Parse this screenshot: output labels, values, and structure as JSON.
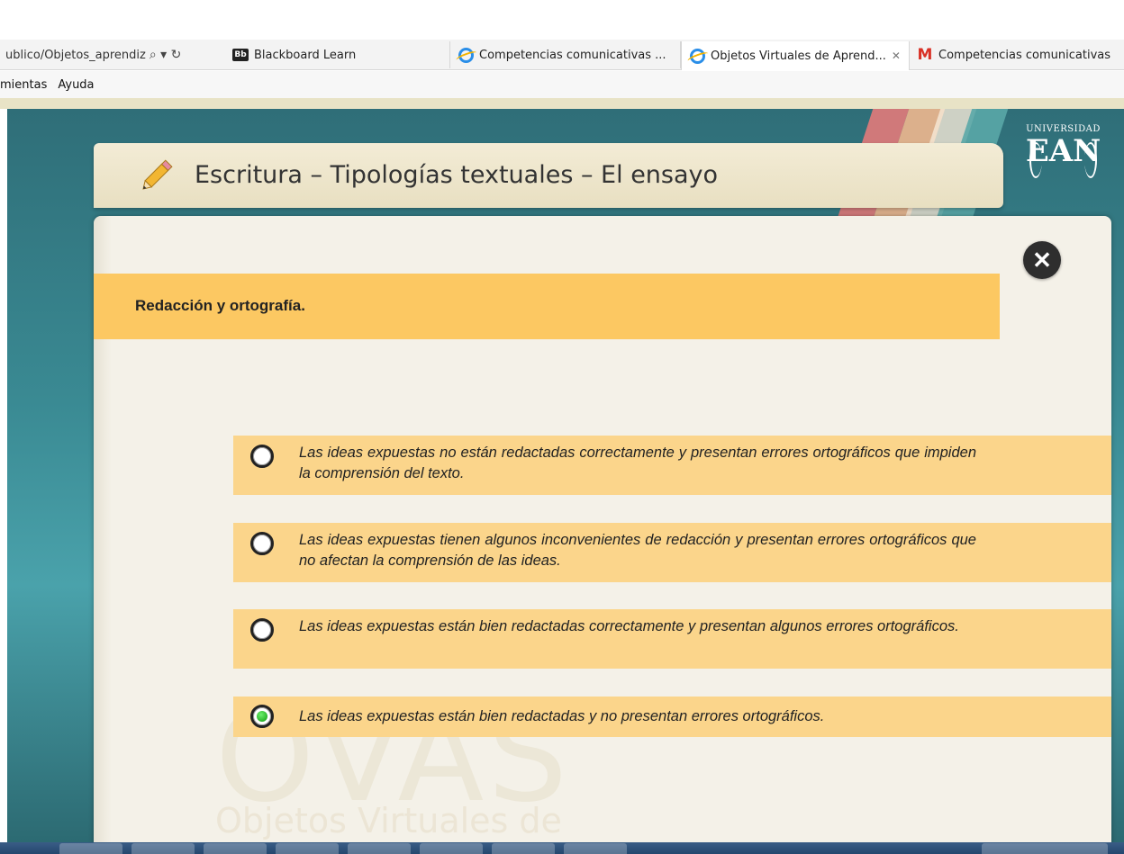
{
  "browser": {
    "address_text": "ublico/Objetos_aprendiz",
    "address_controls": "⌕ ▾ ↻",
    "tabs": [
      {
        "label": "Blackboard Learn",
        "icon": "blackboard-icon",
        "icon_text": "Bb",
        "active": false
      },
      {
        "label": "Competencias comunicativas ...",
        "icon": "internet-explorer-icon",
        "active": false
      },
      {
        "label": "Objetos Virtuales de Aprend...",
        "icon": "internet-explorer-icon",
        "active": true
      },
      {
        "label": "Competencias comunicativas",
        "icon": "gmail-icon",
        "icon_text": "M",
        "active": false
      }
    ],
    "tab_close": "✕",
    "menu": [
      "mientas",
      "Ayuda"
    ]
  },
  "course": {
    "title": "Escritura – Tipologías textuales – El ensayo",
    "logo": {
      "top": "UNIVERSIDAD",
      "main": "EAN"
    },
    "close_symbol": "✕",
    "section_title": "Redacción y ortografía.",
    "watermark_big": "OVAS",
    "watermark_small": "Objetos Virtuales de",
    "options": [
      {
        "text": "Las ideas expuestas no están redactadas correctamente y presentan errores ortográficos que impiden la comprensión del texto.",
        "selected": false
      },
      {
        "text": "Las ideas expuestas tienen algunos inconvenientes de redacción y presentan errores ortográficos que no afectan la comprensión de las ideas.",
        "selected": false
      },
      {
        "text": "Las ideas expuestas están bien redactadas correctamente y presentan algunos errores ortográficos.",
        "selected": false
      },
      {
        "text": "Las ideas expuestas están bien redactadas y no presentan errores ortográficos.",
        "selected": true
      }
    ]
  },
  "colors": {
    "section_bar": "#fcc862",
    "option_bg": "#fbd58b",
    "stage_teal": "#3a8a93",
    "selected_radio": "#0c9a0c"
  }
}
